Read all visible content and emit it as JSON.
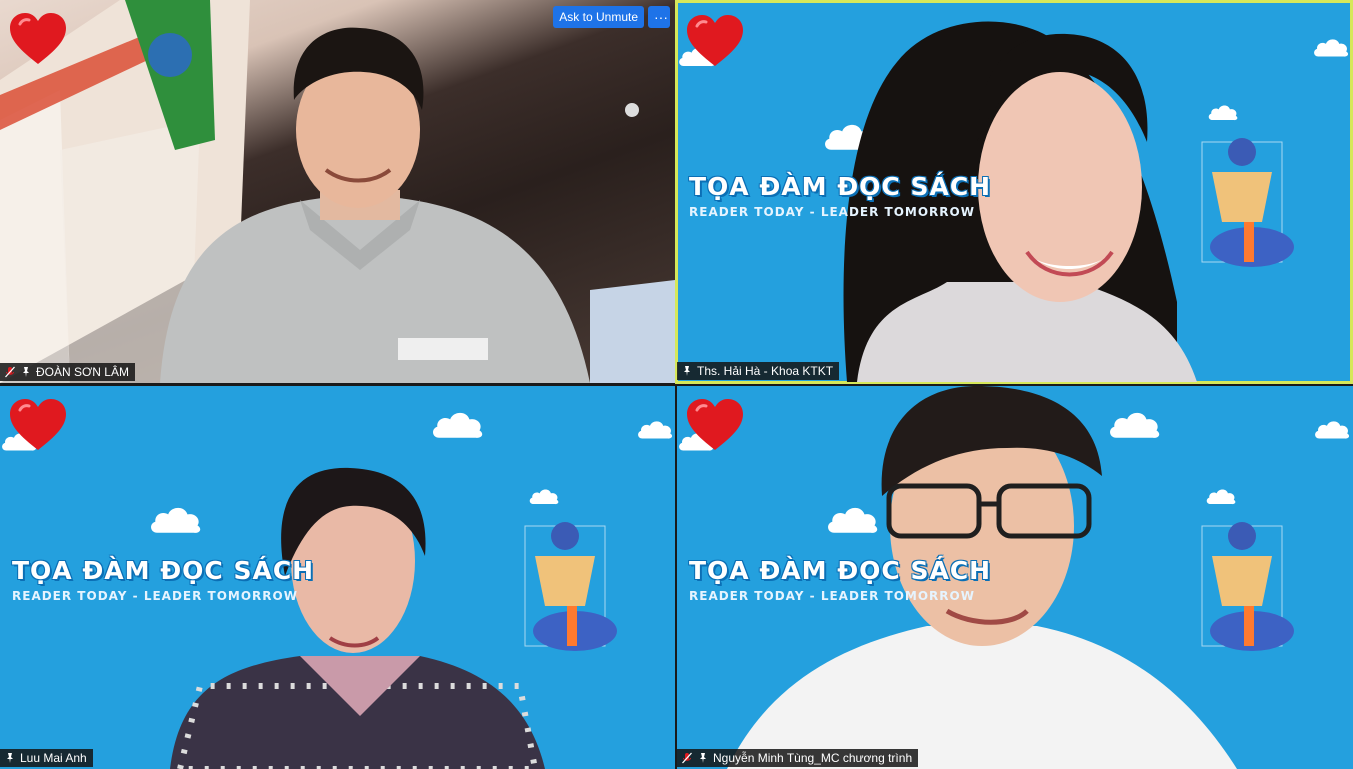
{
  "controls": {
    "unmute_label": "Ask to Unmute",
    "more_label": "···"
  },
  "banner": {
    "title": "TỌA ĐÀM ĐỌC SÁCH",
    "subtitle": "READER TODAY - LEADER TOMORROW"
  },
  "participants": [
    {
      "name": "ĐOÀN SƠN LÂM",
      "muted": true,
      "pinned": true,
      "active_speaker": false,
      "reaction": "heart"
    },
    {
      "name": "Ths. Hải Hà - Khoa KTKT",
      "muted": false,
      "pinned": true,
      "active_speaker": true,
      "reaction": "heart"
    },
    {
      "name": "Luu Mai Anh",
      "muted": false,
      "pinned": true,
      "active_speaker": false,
      "reaction": "heart"
    },
    {
      "name": "Nguyễn Minh Tùng_MC chương trình",
      "muted": true,
      "pinned": true,
      "active_speaker": false,
      "reaction": "heart"
    }
  ],
  "colors": {
    "virtual_bg": "#24a0de",
    "active_border": "#d6e85a",
    "button": "#1e73e8",
    "heart": "#e0191f"
  }
}
